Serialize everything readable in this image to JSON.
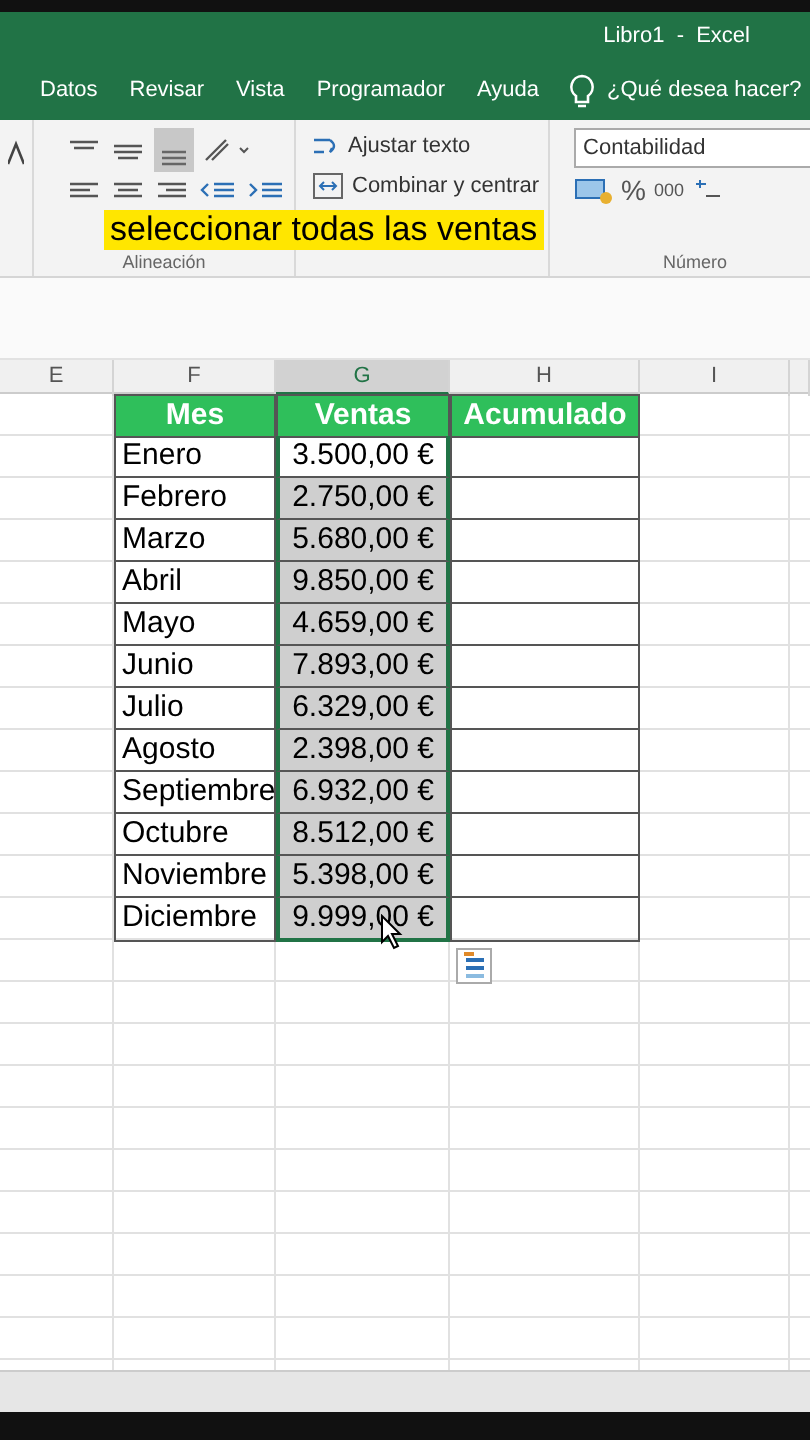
{
  "title": "Libro1  -  Excel",
  "tabs": [
    {
      "label": "Datos"
    },
    {
      "label": "Revisar"
    },
    {
      "label": "Vista"
    },
    {
      "label": "Programador"
    },
    {
      "label": "Ayuda"
    }
  ],
  "tell_me": "¿Qué desea hacer?",
  "ribbon": {
    "wrap_text": "Ajustar texto",
    "merge": "Combinar y centrar",
    "number_format": "Contabilidad",
    "percent": "%",
    "thousands": "000",
    "groups": [
      "Alineación",
      "Número"
    ]
  },
  "caption": "seleccionar todas las ventas",
  "columns": [
    {
      "label": "E",
      "selected": false
    },
    {
      "label": "F",
      "selected": false
    },
    {
      "label": "G",
      "selected": true
    },
    {
      "label": "H",
      "selected": false
    },
    {
      "label": "I",
      "selected": false
    }
  ],
  "table": {
    "headers": [
      "Mes",
      "Ventas",
      "Acumulado"
    ],
    "rows": [
      {
        "month": "Enero",
        "sales": "3.500,00 €",
        "selected": true,
        "active": true
      },
      {
        "month": "Febrero",
        "sales": "2.750,00 €",
        "selected": true,
        "active": false
      },
      {
        "month": "Marzo",
        "sales": "5.680,00 €",
        "selected": true,
        "active": false
      },
      {
        "month": "Abril",
        "sales": "9.850,00 €",
        "selected": true,
        "active": false
      },
      {
        "month": "Mayo",
        "sales": "4.659,00 €",
        "selected": true,
        "active": false
      },
      {
        "month": "Junio",
        "sales": "7.893,00 €",
        "selected": true,
        "active": false
      },
      {
        "month": "Julio",
        "sales": "6.329,00 €",
        "selected": true,
        "active": false
      },
      {
        "month": "Agosto",
        "sales": "2.398,00 €",
        "selected": true,
        "active": false
      },
      {
        "month": "Septiembre",
        "sales": "6.932,00 €",
        "selected": true,
        "active": false
      },
      {
        "month": "Octubre",
        "sales": "8.512,00 €",
        "selected": true,
        "active": false
      },
      {
        "month": "Noviembre",
        "sales": "5.398,00 €",
        "selected": true,
        "active": false
      },
      {
        "month": "Diciembre",
        "sales": "9.999,00 €",
        "selected": true,
        "active": false
      }
    ]
  }
}
